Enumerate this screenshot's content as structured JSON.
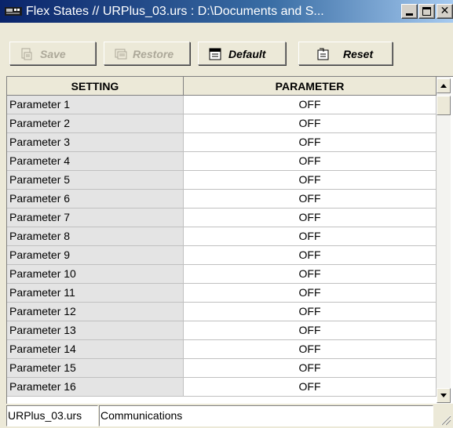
{
  "window": {
    "title": "Flex States // URPlus_03.urs : D:\\Documents and S..."
  },
  "toolbar": {
    "save_label": "Save",
    "restore_label": "Restore",
    "default_label": "Default",
    "reset_label": "Reset"
  },
  "grid": {
    "columns": [
      "SETTING",
      "PARAMETER"
    ],
    "rows": [
      {
        "setting": "Parameter 1",
        "parameter": "OFF"
      },
      {
        "setting": "Parameter 2",
        "parameter": "OFF"
      },
      {
        "setting": "Parameter 3",
        "parameter": "OFF"
      },
      {
        "setting": "Parameter 4",
        "parameter": "OFF"
      },
      {
        "setting": "Parameter 5",
        "parameter": "OFF"
      },
      {
        "setting": "Parameter 6",
        "parameter": "OFF"
      },
      {
        "setting": "Parameter 7",
        "parameter": "OFF"
      },
      {
        "setting": "Parameter 8",
        "parameter": "OFF"
      },
      {
        "setting": "Parameter 9",
        "parameter": "OFF"
      },
      {
        "setting": "Parameter 10",
        "parameter": "OFF"
      },
      {
        "setting": "Parameter 11",
        "parameter": "OFF"
      },
      {
        "setting": "Parameter 12",
        "parameter": "OFF"
      },
      {
        "setting": "Parameter 13",
        "parameter": "OFF"
      },
      {
        "setting": "Parameter 14",
        "parameter": "OFF"
      },
      {
        "setting": "Parameter 15",
        "parameter": "OFF"
      },
      {
        "setting": "Parameter 16",
        "parameter": "OFF"
      }
    ]
  },
  "statusbar": {
    "file": "URPlus_03.urs",
    "connection": "Communications"
  },
  "colors": {
    "title_bar_start": "#0a246a",
    "title_bar_end": "#a6caf0",
    "setting_column_bg": "#e4e4e4",
    "disabled_text": "#aca899"
  },
  "icons": {
    "app": "app-device-icon",
    "save": "save-icon",
    "restore": "restore-icon",
    "default": "default-icon",
    "reset": "reset-icon"
  }
}
